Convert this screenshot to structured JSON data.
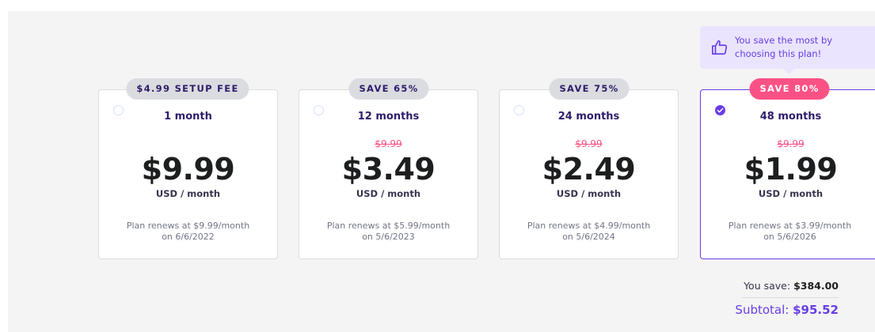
{
  "tooltip": {
    "icon": "thumbs-up-icon",
    "text": "You save the most by choosing this plan!"
  },
  "plans": [
    {
      "badge": "$4.99 SETUP FEE",
      "period": "1 month",
      "old_price": "",
      "price": "$9.99",
      "unit": "USD / month",
      "renew_line1": "Plan renews at $9.99/month",
      "renew_line2": "on 6/6/2022",
      "selected": false
    },
    {
      "badge": "SAVE 65%",
      "period": "12 months",
      "old_price": "$9.99",
      "price": "$3.49",
      "unit": "USD / month",
      "renew_line1": "Plan renews at $5.99/month",
      "renew_line2": "on 5/6/2023",
      "selected": false
    },
    {
      "badge": "SAVE 75%",
      "period": "24 months",
      "old_price": "$9.99",
      "price": "$2.49",
      "unit": "USD / month",
      "renew_line1": "Plan renews at $4.99/month",
      "renew_line2": "on 5/6/2024",
      "selected": false
    },
    {
      "badge": "SAVE 80%",
      "period": "48 months",
      "old_price": "$9.99",
      "price": "$1.99",
      "unit": "USD / month",
      "renew_line1": "Plan renews at $3.99/month",
      "renew_line2": "on 5/6/2026",
      "selected": true
    }
  ],
  "summary": {
    "save_label": "You save:",
    "save_value": "$384.00",
    "subtotal_label": "Subtotal:",
    "subtotal_value": "$95.52"
  },
  "colors": {
    "accent": "#673de6",
    "hot_badge": "#fc5185",
    "badge": "#dadce0"
  }
}
